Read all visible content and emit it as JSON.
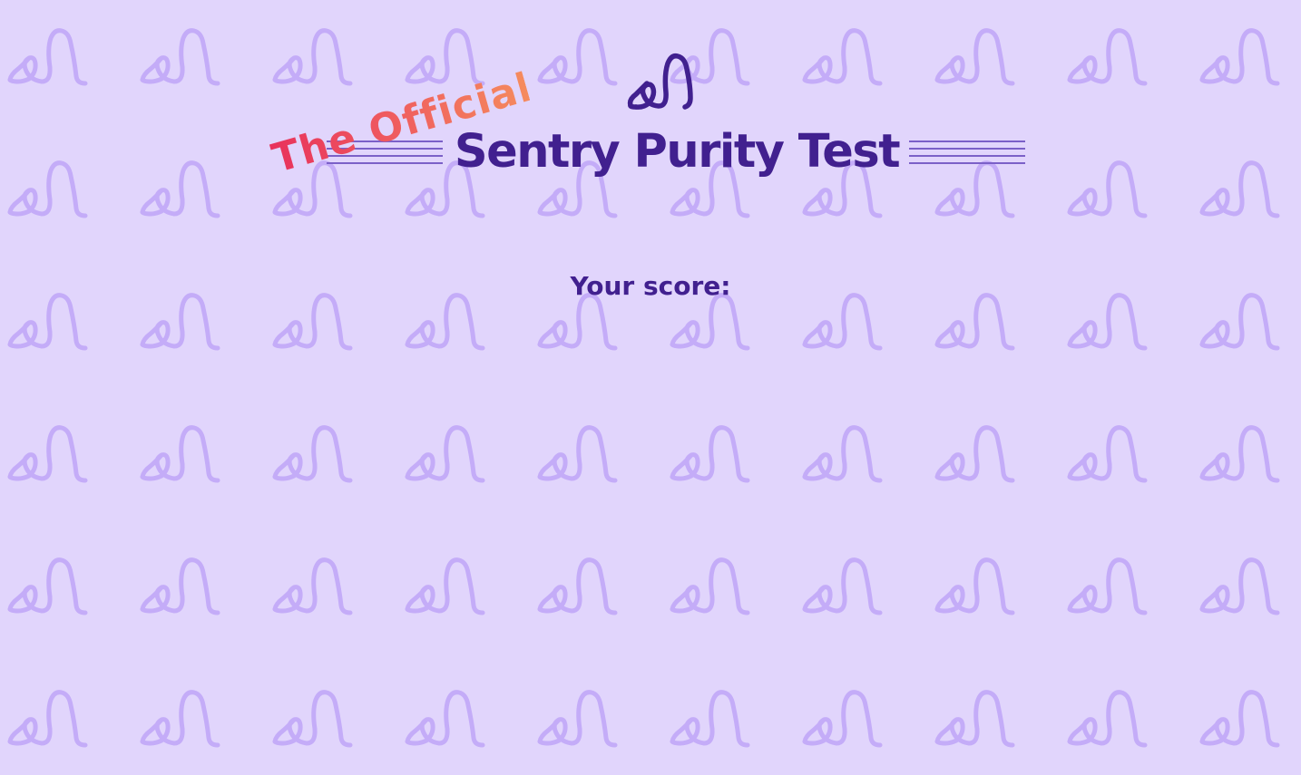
{
  "header": {
    "tagline": "The Official",
    "title": "Sentry Purity Test",
    "logo_icon": "sentry-logo-icon"
  },
  "result": {
    "score_label": "Your score:"
  },
  "colors": {
    "background": "#e1d5fc",
    "pattern": "#c4acf8",
    "title": "#41208f",
    "tagline_gradient_start": "#e8325c",
    "tagline_gradient_end": "#f58b5e",
    "accent_lines": "#7b60c8"
  },
  "background_pattern_icon": "sentry-glyph-icon"
}
